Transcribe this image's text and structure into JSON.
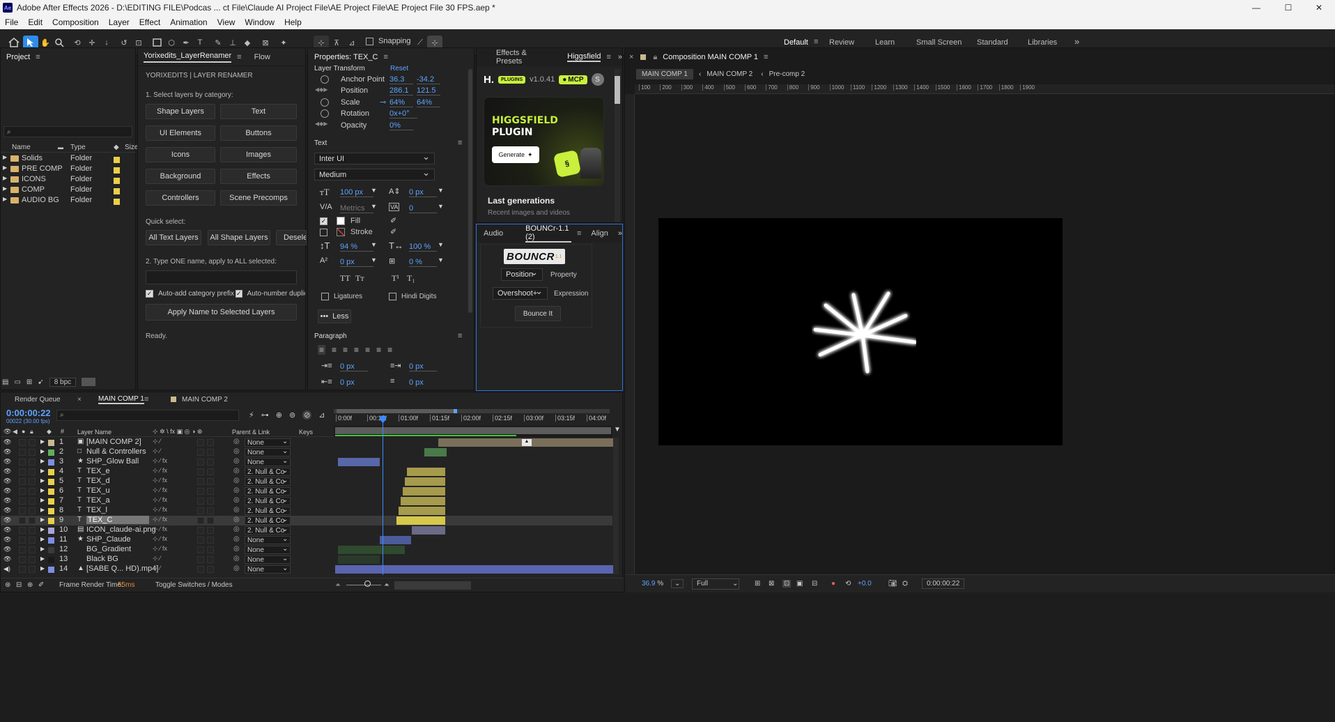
{
  "app": {
    "title": "Adobe After Effects 2026 - D:\\EDITING FILE\\Podcas ... ct File\\Claude AI Project File\\AE Project File\\AE Project File 30 FPS.aep *",
    "logo": "Ae",
    "win_min": "—",
    "win_max": "☐",
    "win_close": "✕"
  },
  "menu": [
    "File",
    "Edit",
    "Composition",
    "Layer",
    "Effect",
    "Animation",
    "View",
    "Window",
    "Help"
  ],
  "toolbar": {
    "snapping_label": "Snapping",
    "workspaces": [
      "Default",
      "Review",
      "Learn",
      "Small Screen",
      "Standard",
      "Libraries"
    ],
    "active_workspace": "Default",
    "more": "»"
  },
  "project": {
    "tab": "Project",
    "search_placeholder": "",
    "columns": {
      "name": "Name",
      "type": "Type",
      "size": "Size"
    },
    "items": [
      {
        "name": "Solids",
        "type": "Folder"
      },
      {
        "name": "PRE COMP",
        "type": "Folder"
      },
      {
        "name": "ICONS",
        "type": "Folder"
      },
      {
        "name": "COMP",
        "type": "Folder"
      },
      {
        "name": "AUDIO BG",
        "type": "Folder"
      }
    ],
    "bpc": "8 bpc"
  },
  "renamer": {
    "tab": "Yorixedits_LayerRenamer",
    "tab2": "Flow",
    "heading": "YORIXEDITS  |  LAYER RENAMER",
    "step1": "1. Select layers by category:",
    "categories": [
      "Shape Layers",
      "Text",
      "UI Elements",
      "Buttons",
      "Icons",
      "Images",
      "Background",
      "Effects",
      "Controllers",
      "Scene Precomps"
    ],
    "quick_select": "Quick select:",
    "quick_buttons": [
      "All Text Layers",
      "All Shape Layers",
      "Deselect"
    ],
    "step2": "2. Type ONE name, apply to ALL selected:",
    "name_value": "",
    "auto_prefix": "Auto-add category prefix",
    "auto_number": "Auto-number duplicates",
    "apply": "Apply Name to Selected Layers",
    "status": "Ready."
  },
  "properties": {
    "tab": "Properties: TEX_C",
    "layer_transform": "Layer Transform",
    "reset": "Reset",
    "rows": [
      {
        "label": "Anchor Point",
        "v1": "36.3",
        "v2": "-34.2"
      },
      {
        "label": "Position",
        "v1": "286.1",
        "v2": "121.5"
      },
      {
        "label": "Scale",
        "v1": "64%",
        "v2": "64%"
      },
      {
        "label": "Rotation",
        "v1": "0x+0°",
        "v2": ""
      },
      {
        "label": "Opacity",
        "v1": "0%",
        "v2": ""
      }
    ],
    "text_section": "Text",
    "font": "Inter UI",
    "weight": "Medium",
    "font_size": "100 px",
    "leading": "0 px",
    "kerning": "Metrics",
    "tracking": "0",
    "fill": "Fill",
    "stroke": "Stroke",
    "vscale": "94 %",
    "hscale": "100 %",
    "baseline": "0 px",
    "tsume": "0 %",
    "ligatures": "Ligatures",
    "hindi": "Hindi Digits",
    "less": "Less",
    "paragraph": "Paragraph",
    "indent1": "0 px",
    "indent2": "0 px",
    "indent3": "0 px",
    "indent4": "0 px"
  },
  "effects": {
    "tab1": "Effects & Presets",
    "tab2": "Higgsfield",
    "brand": "H.",
    "plugins_badge": "PLUGINS",
    "version": "v1.0.41",
    "mcp": "MCP",
    "avatar": "S",
    "card_title_1": "HIGGSFIELD",
    "card_title_2": "PLUGIN",
    "generate": "Generate",
    "last_gen": "Last generations",
    "last_gen_sub": "Recent images and videos"
  },
  "bounce": {
    "tab_audio": "Audio",
    "tab_bounce": "BOUNCr-1.1 (2)",
    "tab_align": "Align",
    "logo": "BOUNCR",
    "logo_ver": "1.1",
    "property_select": "Position",
    "property_label": "Property",
    "expression_select": "Overshoot+",
    "expression_label": "Expression",
    "bounce_btn": "Bounce It"
  },
  "composition": {
    "tab": "Composition MAIN COMP 1",
    "breadcrumbs": [
      "MAIN COMP 1",
      "MAIN COMP 2",
      "Pre-comp 2"
    ],
    "ruler_labels": [
      "100",
      "200",
      "300",
      "400",
      "500",
      "600",
      "700",
      "800",
      "900",
      "1000",
      "1100",
      "1200",
      "1300",
      "1400",
      "1500",
      "1600",
      "1700",
      "1800",
      "1900"
    ],
    "zoom": "36.9",
    "zoom_unit": "%",
    "resolution": "Full",
    "exposure": "+0.0",
    "timecode": "0:00:00:22"
  },
  "timeline": {
    "tabs": [
      "Render Queue",
      "MAIN COMP 1",
      "MAIN COMP 2"
    ],
    "timecode": "0:00:00:22",
    "frame_info": "00022 (30.00 fps)",
    "col_layer_name": "Layer Name",
    "col_parent": "Parent & Link",
    "col_keys": "Keys",
    "time_labels": [
      "0:00f",
      "00:15f",
      "01:00f",
      "01:15f",
      "02:00f",
      "02:15f",
      "03:00f",
      "03:15f",
      "04:00f"
    ],
    "frame_render_label": "Frame Render Time:",
    "frame_render_value": "55ms",
    "toggle": "Toggle Switches / Modes",
    "colors": {
      "main_comp_2": "#7a6f5a",
      "null": "#4a7a4a",
      "glow_ball": "#5867a8",
      "text_bar": "#a69a4c",
      "text_bar_selected": "#d6c84a",
      "icon": "#6c6a86",
      "shp_claude": "#4c5c9a",
      "bg_grad": "#2f4a2f",
      "black_bg": "#2a3a2a",
      "audio": "#5a64b0"
    },
    "layers": [
      {
        "num": "1",
        "name": "[MAIN COMP 2]",
        "parent": "None",
        "label": "#c9b98f",
        "icon": "▣"
      },
      {
        "num": "2",
        "name": "Null & Controllers",
        "parent": "None",
        "label": "#5fb05f",
        "icon": "□"
      },
      {
        "num": "3",
        "name": "SHP_Glow Ball",
        "parent": "None",
        "label": "#7d8ee0",
        "icon": "★"
      },
      {
        "num": "4",
        "name": "TEX_e",
        "parent": "2. Null & Co",
        "label": "#e9d04a",
        "icon": "T"
      },
      {
        "num": "5",
        "name": "TEX_d",
        "parent": "2. Null & Co",
        "label": "#e9d04a",
        "icon": "T"
      },
      {
        "num": "6",
        "name": "TEX_u",
        "parent": "2. Null & Co",
        "label": "#e9d04a",
        "icon": "T"
      },
      {
        "num": "7",
        "name": "TEX_a",
        "parent": "2. Null & Co",
        "label": "#e9d04a",
        "icon": "T"
      },
      {
        "num": "8",
        "name": "TEX_l",
        "parent": "2. Null & Co",
        "label": "#e9d04a",
        "icon": "T"
      },
      {
        "num": "9",
        "name": "TEX_C",
        "parent": "2. Null & Co",
        "label": "#e9d04a",
        "icon": "T"
      },
      {
        "num": "10",
        "name": "ICON_claude-ai.png",
        "parent": "2. Null & Co",
        "label": "#a9a4d6",
        "icon": "▤"
      },
      {
        "num": "11",
        "name": "SHP_Claude",
        "parent": "None",
        "label": "#7d8ee0",
        "icon": "★"
      },
      {
        "num": "12",
        "name": "BG_Gradient",
        "parent": "None",
        "label": "#3a3a3a",
        "icon": ""
      },
      {
        "num": "13",
        "name": "Black BG",
        "parent": "None",
        "label": "#1a1a1a",
        "icon": ""
      },
      {
        "num": "14",
        "name": "[SABE Q... HD).mp4]",
        "parent": "None",
        "label": "#7d8ee0",
        "icon": "▲"
      }
    ]
  }
}
